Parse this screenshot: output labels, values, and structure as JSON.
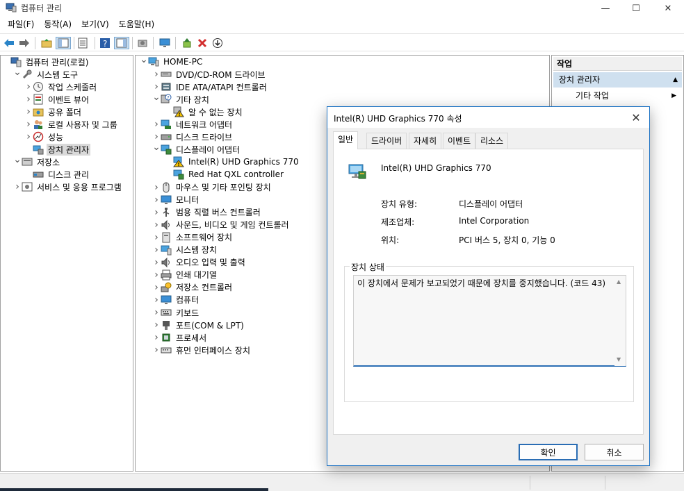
{
  "window": {
    "title": "컴퓨터 관리",
    "minimize": "—",
    "maximize": "☐",
    "close": "✕"
  },
  "menu": [
    "파일(F)",
    "동작(A)",
    "보기(V)",
    "도움말(H)"
  ],
  "toolbar": [
    "back-arrow-icon",
    "forward-arrow-icon",
    "up-folder-icon",
    "show-hide-tree-icon",
    "properties-icon",
    "help-icon",
    "action-pane-icon",
    "scan-hardware-icon",
    "monitor-icon",
    "update-driver-icon",
    "uninstall-icon",
    "disable-icon"
  ],
  "left_tree": [
    {
      "label": "컴퓨터 관리(로컬)",
      "depth": 0,
      "chev": "",
      "icon": "computer-mgmt"
    },
    {
      "label": "시스템 도구",
      "depth": 1,
      "chev": "v",
      "icon": "tools"
    },
    {
      "label": "작업 스케줄러",
      "depth": 2,
      "chev": ">",
      "icon": "clock"
    },
    {
      "label": "이벤트 뷰어",
      "depth": 2,
      "chev": ">",
      "icon": "event"
    },
    {
      "label": "공유 폴더",
      "depth": 2,
      "chev": ">",
      "icon": "share"
    },
    {
      "label": "로컬 사용자 및 그룹",
      "depth": 2,
      "chev": ">",
      "icon": "users"
    },
    {
      "label": "성능",
      "depth": 2,
      "chev": ">",
      "icon": "perf"
    },
    {
      "label": "장치 관리자",
      "depth": 2,
      "chev": "",
      "icon": "devmgr",
      "selected": true
    },
    {
      "label": "저장소",
      "depth": 1,
      "chev": "v",
      "icon": "storage"
    },
    {
      "label": "디스크 관리",
      "depth": 2,
      "chev": "",
      "icon": "disk"
    },
    {
      "label": "서비스 및 응용 프로그램",
      "depth": 1,
      "chev": ">",
      "icon": "services"
    }
  ],
  "device_tree": [
    {
      "label": "HOME-PC",
      "depth": 0,
      "chev": "v",
      "icon": "pc"
    },
    {
      "label": "DVD/CD-ROM 드라이브",
      "depth": 1,
      "chev": ">",
      "icon": "dvd"
    },
    {
      "label": "IDE ATA/ATAPI 컨트롤러",
      "depth": 1,
      "chev": ">",
      "icon": "ide"
    },
    {
      "label": "기타 장치",
      "depth": 1,
      "chev": "v",
      "icon": "other"
    },
    {
      "label": "알 수 없는 장치",
      "depth": 2,
      "chev": "",
      "icon": "warn"
    },
    {
      "label": "네트워크 어댑터",
      "depth": 1,
      "chev": ">",
      "icon": "net"
    },
    {
      "label": "디스크 드라이브",
      "depth": 1,
      "chev": ">",
      "icon": "drive"
    },
    {
      "label": "디스플레이 어댑터",
      "depth": 1,
      "chev": "v",
      "icon": "display"
    },
    {
      "label": "Intel(R) UHD Graphics 770",
      "depth": 2,
      "chev": "",
      "icon": "display-warn"
    },
    {
      "label": "Red Hat QXL controller",
      "depth": 2,
      "chev": "",
      "icon": "display"
    },
    {
      "label": "마우스 및 기타 포인팅 장치",
      "depth": 1,
      "chev": ">",
      "icon": "mouse"
    },
    {
      "label": "모니터",
      "depth": 1,
      "chev": ">",
      "icon": "monitor"
    },
    {
      "label": "범용 직렬 버스 컨트롤러",
      "depth": 1,
      "chev": ">",
      "icon": "usb"
    },
    {
      "label": "사운드, 비디오 및 게임 컨트롤러",
      "depth": 1,
      "chev": ">",
      "icon": "sound"
    },
    {
      "label": "소프트웨어 장치",
      "depth": 1,
      "chev": ">",
      "icon": "software"
    },
    {
      "label": "시스템 장치",
      "depth": 1,
      "chev": ">",
      "icon": "system"
    },
    {
      "label": "오디오 입력 및 출력",
      "depth": 1,
      "chev": ">",
      "icon": "sound"
    },
    {
      "label": "인쇄 대기열",
      "depth": 1,
      "chev": ">",
      "icon": "print"
    },
    {
      "label": "저장소 컨트롤러",
      "depth": 1,
      "chev": ">",
      "icon": "storagectl"
    },
    {
      "label": "컴퓨터",
      "depth": 1,
      "chev": ">",
      "icon": "monitor"
    },
    {
      "label": "키보드",
      "depth": 1,
      "chev": ">",
      "icon": "keyboard"
    },
    {
      "label": "포트(COM & LPT)",
      "depth": 1,
      "chev": ">",
      "icon": "port"
    },
    {
      "label": "프로세서",
      "depth": 1,
      "chev": ">",
      "icon": "cpu"
    },
    {
      "label": "휴먼 인터페이스 장치",
      "depth": 1,
      "chev": ">",
      "icon": "hid"
    }
  ],
  "actions": {
    "header": "작업",
    "section": "장치 관리자",
    "section_arrow": "▲",
    "item": "기타 작업",
    "item_arrow": "▶"
  },
  "dialog": {
    "title": "Intel(R) UHD Graphics 770 속성",
    "close": "✕",
    "tabs": [
      "일반",
      "드라이버",
      "자세히",
      "이벤트",
      "리소스"
    ],
    "active_tab": "일반",
    "device_name": "Intel(R) UHD Graphics 770",
    "props": [
      {
        "key": "장치 유형:",
        "value": "디스플레이 어댑터"
      },
      {
        "key": "제조업체:",
        "value": "Intel Corporation"
      },
      {
        "key": "위치:",
        "value": "PCI 버스 5, 장치 0, 기능 0"
      }
    ],
    "status_legend": "장치 상태",
    "status_text": "이 장치에서 문제가 보고되었기 때문에 장치를 중지했습니다. (코드 43)",
    "ok": "확인",
    "cancel": "취소"
  }
}
